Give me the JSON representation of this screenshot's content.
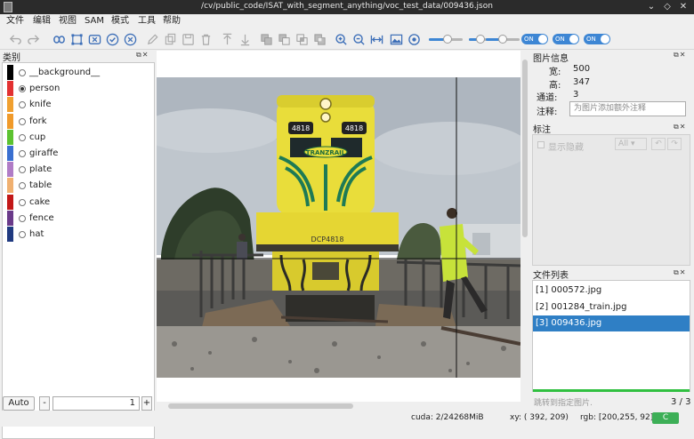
{
  "window": {
    "title": "/cv/public_code/ISAT_with_segment_anything/voc_test_data/009436.json"
  },
  "menu": [
    "文件",
    "编辑",
    "视图",
    "SAM",
    "模式",
    "工具",
    "帮助"
  ],
  "toolbar": {
    "icons": [
      "undo-icon",
      "redo-icon",
      "segment-anything-icon",
      "draw-polygon-icon",
      "cancel-icon",
      "finish-icon",
      "delete-icon",
      "edit-icon",
      "copy-icon",
      "save-icon",
      "delete-annotation-icon",
      "to-top-icon",
      "to-bottom-icon",
      "union-icon",
      "subtract-icon",
      "intersect-icon",
      "exclude-icon",
      "zoom-in-icon",
      "zoom-out-icon",
      "fit-window-icon",
      "show-image-icon",
      "show-mask-icon"
    ],
    "slider1_value": 0.55,
    "slider2_value": 0.35,
    "slider3_value": 0.5,
    "toggles": [
      "ON",
      "ON",
      "ON"
    ]
  },
  "categories": {
    "title": "类别",
    "items": [
      {
        "label": "__background__",
        "color": "#000000",
        "checked": false
      },
      {
        "label": "person",
        "color": "#e23131",
        "checked": true
      },
      {
        "label": "knife",
        "color": "#f0a030",
        "checked": false
      },
      {
        "label": "fork",
        "color": "#f09a2a",
        "checked": false
      },
      {
        "label": "cup",
        "color": "#5cc230",
        "checked": false
      },
      {
        "label": "giraffe",
        "color": "#3a6fd0",
        "checked": false
      },
      {
        "label": "plate",
        "color": "#b07cc6",
        "checked": false
      },
      {
        "label": "table",
        "color": "#f0b070",
        "checked": false
      },
      {
        "label": "cake",
        "color": "#c21818",
        "checked": false
      },
      {
        "label": "fence",
        "color": "#6a3a8a",
        "checked": false
      },
      {
        "label": "hat",
        "color": "#203a80",
        "checked": false
      }
    ],
    "auto_label": "Auto",
    "minus_label": "-",
    "group_value": "1",
    "plus_label": "+"
  },
  "image_info": {
    "title": "图片信息",
    "width_label": "宽:",
    "width_value": "500",
    "height_label": "高:",
    "height_value": "347",
    "channels_label": "通道:",
    "channels_value": "3",
    "note_label": "注释:",
    "note_placeholder": "为图片添加额外注释"
  },
  "annotations": {
    "title": "标注",
    "show_hidden": "显示隐藏",
    "filter_value": "All"
  },
  "files": {
    "title": "文件列表",
    "items": [
      "[1] 000572.jpg",
      "[2] 001284_train.jpg",
      "[3] 009436.jpg"
    ],
    "selected_index": 2,
    "jump_placeholder": "跳转到指定图片.",
    "pager": "3 / 3"
  },
  "photo_text": {
    "loco_number": "4818",
    "loco_side": "DCP4818",
    "logo": "TRANZRAIL"
  },
  "status": {
    "cuda": "cuda: 2/24268MiB",
    "xy": "xy: ( 392, 209)",
    "rgb": "rgb: [200,255, 92]",
    "chip": "C"
  }
}
